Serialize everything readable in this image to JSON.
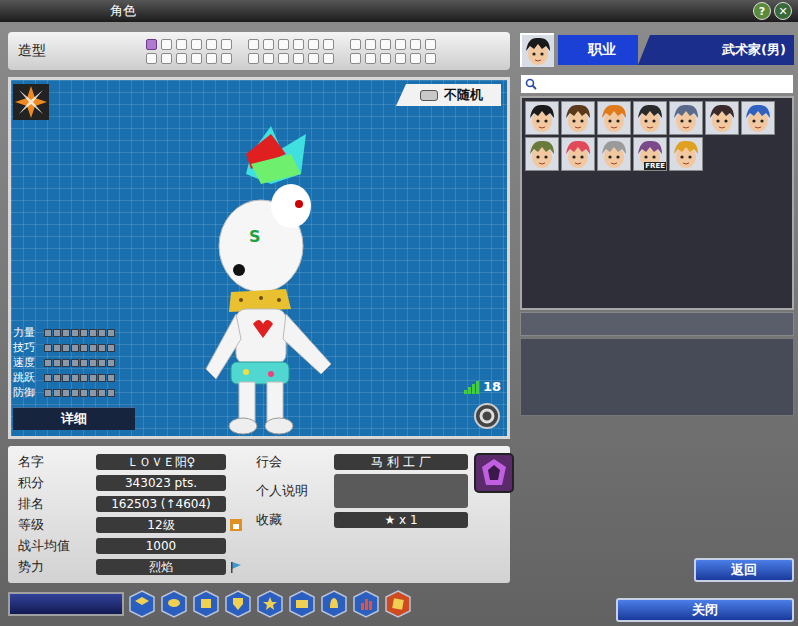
{
  "window": {
    "title": "角色",
    "help_label": "?",
    "close_label": "✕"
  },
  "appearance": {
    "label": "造型",
    "groups": [
      [
        {
          "selected": true
        },
        {
          "selected": false
        },
        {
          "selected": false
        },
        {
          "selected": false
        },
        {
          "selected": false
        },
        {
          "selected": false
        },
        {
          "selected": false
        },
        {
          "selected": false
        },
        {
          "selected": false
        },
        {
          "selected": false
        },
        {
          "selected": false
        },
        {
          "selected": false
        }
      ],
      [
        {
          "selected": false
        },
        {
          "selected": false
        },
        {
          "selected": false
        },
        {
          "selected": false
        },
        {
          "selected": false
        },
        {
          "selected": false
        },
        {
          "selected": false
        },
        {
          "selected": false
        },
        {
          "selected": false
        },
        {
          "selected": false
        },
        {
          "selected": false
        },
        {
          "selected": false
        }
      ],
      [
        {
          "selected": false
        },
        {
          "selected": false
        },
        {
          "selected": false
        },
        {
          "selected": false
        },
        {
          "selected": false
        },
        {
          "selected": false
        },
        {
          "selected": false
        },
        {
          "selected": false
        },
        {
          "selected": false
        },
        {
          "selected": false
        },
        {
          "selected": false
        },
        {
          "selected": false
        }
      ]
    ]
  },
  "preview": {
    "random_toggle": {
      "label": "不随机",
      "on": false
    },
    "character_emblem": "S",
    "stats": [
      {
        "label": "力量",
        "level": 0
      },
      {
        "label": "技巧",
        "level": 0
      },
      {
        "label": "速度",
        "level": 0
      },
      {
        "label": "跳跃",
        "level": 0
      },
      {
        "label": "防御",
        "level": 0
      }
    ],
    "detail_button": "详细",
    "ping": "18"
  },
  "profile": {
    "left": [
      {
        "label": "名字",
        "value": "ＬＯＶＥ阳♀",
        "kind": "text"
      },
      {
        "label": "积分",
        "value": "343023 pts.",
        "kind": "text"
      },
      {
        "label": "排名",
        "value": "162503 (↑4604)",
        "kind": "text"
      },
      {
        "label": "等级",
        "value": "12级",
        "kind": "level"
      },
      {
        "label": "战斗均值",
        "value": "1000",
        "kind": "text"
      },
      {
        "label": "势力",
        "value": "烈焰",
        "kind": "faction"
      }
    ],
    "guild": {
      "label": "行会",
      "value": "马 利 工 厂"
    },
    "description": {
      "label": "个人说明",
      "value": ""
    },
    "collection": {
      "label": "收藏",
      "value": "★ x 1"
    }
  },
  "job_panel": {
    "tab": "职业",
    "value": "武术家(男)",
    "search": {
      "value": ""
    },
    "free_label": "FREE",
    "characters": [
      {
        "color": "#1a1a1a",
        "free": false,
        "selected": false
      },
      {
        "color": "#5a3a1a",
        "free": false,
        "selected": false
      },
      {
        "color": "#e07a1a",
        "free": false,
        "selected": false
      },
      {
        "color": "#2a2a2a",
        "free": false,
        "selected": false
      },
      {
        "color": "#5a6a8a",
        "free": false,
        "selected": false
      },
      {
        "color": "#3a2a2a",
        "free": false,
        "selected": false
      },
      {
        "color": "#3060c0",
        "free": false,
        "selected": false
      },
      {
        "color": "#6a7a3a",
        "free": false,
        "selected": false
      },
      {
        "color": "#e04a5a",
        "free": false,
        "selected": false
      },
      {
        "color": "#9a9a9a",
        "free": false,
        "selected": false
      },
      {
        "color": "#7a4a8a",
        "free": true,
        "selected": false
      },
      {
        "color": "#e0a020",
        "free": false,
        "selected": false
      }
    ]
  },
  "back_button": "返回",
  "close_button": "关闭",
  "toolbar": [
    {
      "kind": "cube",
      "color": "#2a5fc0"
    },
    {
      "kind": "chat",
      "color": "#2a5fc0"
    },
    {
      "kind": "box",
      "color": "#2a5fc0"
    },
    {
      "kind": "shield",
      "color": "#2a5fc0"
    },
    {
      "kind": "star",
      "color": "#2a5fc0"
    },
    {
      "kind": "folder",
      "color": "#2a5fc0"
    },
    {
      "kind": "bell",
      "color": "#2a5fc0"
    },
    {
      "kind": "chart",
      "color": "#2a5fc0"
    },
    {
      "kind": "gem",
      "color": "#d04a20"
    }
  ]
}
